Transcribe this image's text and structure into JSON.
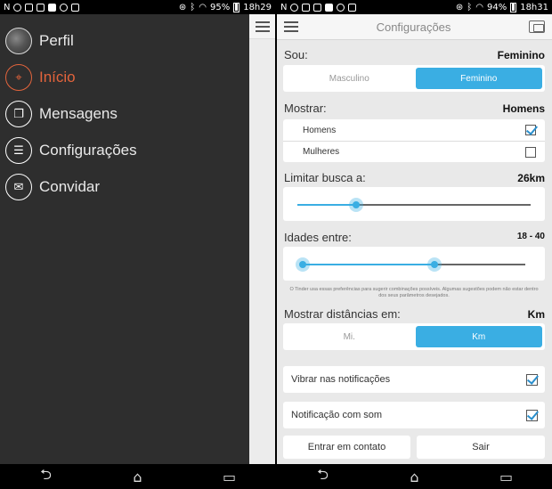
{
  "left": {
    "status": {
      "time": "18h29",
      "battery": "95%"
    },
    "menu": [
      {
        "label": "Perfil",
        "icon": "profile-avatar",
        "active": false
      },
      {
        "label": "Início",
        "icon": "location-pin-icon",
        "active": true
      },
      {
        "label": "Mensagens",
        "icon": "chat-bubbles-icon",
        "active": false
      },
      {
        "label": "Configurações",
        "icon": "sliders-icon",
        "active": false
      },
      {
        "label": "Convidar",
        "icon": "invite-mail-icon",
        "active": false
      }
    ]
  },
  "right": {
    "status": {
      "time": "18h31",
      "battery": "94%"
    },
    "title": "Configurações",
    "gender": {
      "label": "Sou:",
      "value": "Feminino",
      "options": [
        "Masculino",
        "Feminino"
      ],
      "selected": 1
    },
    "show": {
      "label": "Mostrar:",
      "value": "Homens",
      "options": [
        {
          "label": "Homens",
          "checked": true
        },
        {
          "label": "Mulheres",
          "checked": false
        }
      ]
    },
    "distance": {
      "label": "Limitar busca a:",
      "value": "26km",
      "level": 0.25
    },
    "ages": {
      "label": "Idades entre:",
      "value": "18 - 40",
      "min_level": 0.0,
      "max_level": 0.59
    },
    "footnote": "O Tinder usa essas preferências para sugerir combinações possíveis. Algumas sugestões podem não estar dentro dos seus parâmetros desejados.",
    "units": {
      "label": "Mostrar distâncias em:",
      "value": "Km",
      "options": [
        "Mi.",
        "Km"
      ],
      "selected": 1
    },
    "vibrate": {
      "label": "Vibrar nas notificações",
      "checked": true
    },
    "sound": {
      "label": "Notificação com som",
      "checked": true
    },
    "buttons": {
      "contact": "Entrar em contato",
      "exit": "Sair"
    }
  },
  "colors": {
    "accent": "#3aaee3",
    "active_menu": "#e3643c",
    "drawer_bg": "#2e2e2e"
  }
}
